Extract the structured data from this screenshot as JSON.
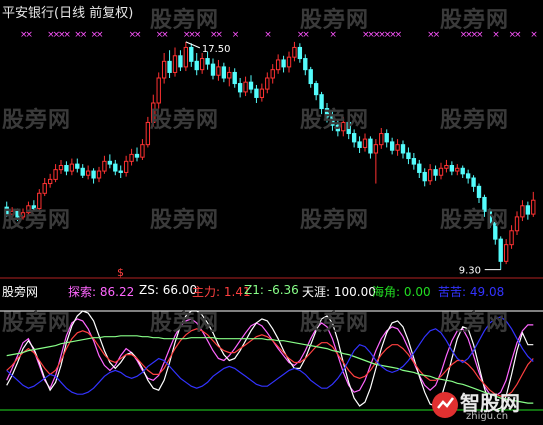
{
  "title": "平安银行(日线 前复权)",
  "watermark": "股旁网",
  "price_high_label": "17.50",
  "price_low_label": "9.30",
  "dollar_marker": "$",
  "indicator_bar": {
    "name": "股旁网",
    "items": [
      {
        "label": "探索:",
        "value": "86.22",
        "color": "#ff66ff"
      },
      {
        "label": "ZS:",
        "value": "66.00",
        "color": "#ffffff"
      },
      {
        "label": "主力:",
        "value": "1.41",
        "color": "#ff4040"
      },
      {
        "label": "Z1:",
        "value": "-6.36",
        "color": "#88ff88"
      },
      {
        "label": "天涯:",
        "value": "100.00",
        "color": "#ffffff"
      },
      {
        "label": "海角:",
        "value": "0.00",
        "color": "#22dd22"
      },
      {
        "label": "苦苦:",
        "value": "49.08",
        "color": "#3333ff"
      }
    ]
  },
  "logo": {
    "main": "智股网",
    "sub": "zhigu.cn"
  },
  "colors": {
    "up": "#ff3232",
    "down": "#54fcfc",
    "marker": "#ff55ff"
  },
  "chart_data": [
    {
      "type": "candlestick",
      "title": "平安银行(日线 前复权)",
      "annotations": [
        {
          "label": "17.50",
          "kind": "high"
        },
        {
          "label": "9.30",
          "kind": "low"
        }
      ],
      "ylim": [
        9.0,
        18.0
      ],
      "candles": [
        [
          11.55,
          11.3,
          11.75,
          11.2
        ],
        [
          11.3,
          11.4,
          11.55,
          11.15
        ],
        [
          11.4,
          11.2,
          11.5,
          11.05
        ],
        [
          11.2,
          11.35,
          11.5,
          11.1
        ],
        [
          11.35,
          11.6,
          11.75,
          11.25
        ],
        [
          11.6,
          11.5,
          11.8,
          11.4
        ],
        [
          11.5,
          12.05,
          12.2,
          11.45
        ],
        [
          12.05,
          12.4,
          12.6,
          11.95
        ],
        [
          12.4,
          12.55,
          12.75,
          12.25
        ],
        [
          12.55,
          12.9,
          13.1,
          12.45
        ],
        [
          12.9,
          13.05,
          13.25,
          12.75
        ],
        [
          13.05,
          12.85,
          13.2,
          12.7
        ],
        [
          12.85,
          13.1,
          13.3,
          12.7
        ],
        [
          13.1,
          12.95,
          13.3,
          12.8
        ],
        [
          12.95,
          12.7,
          13.1,
          12.6
        ],
        [
          12.7,
          12.85,
          13.05,
          12.55
        ],
        [
          12.85,
          12.6,
          12.95,
          12.4
        ],
        [
          12.6,
          12.85,
          13.0,
          12.45
        ],
        [
          12.85,
          13.2,
          13.4,
          12.75
        ],
        [
          13.2,
          13.1,
          13.45,
          12.95
        ],
        [
          13.1,
          12.85,
          13.25,
          12.7
        ],
        [
          12.85,
          12.8,
          13.05,
          12.6
        ],
        [
          12.8,
          13.2,
          13.4,
          12.65
        ],
        [
          13.2,
          13.45,
          13.65,
          13.05
        ],
        [
          13.45,
          13.35,
          13.7,
          13.2
        ],
        [
          13.35,
          13.8,
          14.0,
          13.25
        ],
        [
          13.8,
          14.6,
          14.8,
          13.7
        ],
        [
          14.6,
          15.3,
          15.6,
          14.45
        ],
        [
          15.3,
          16.2,
          16.4,
          15.1
        ],
        [
          16.2,
          16.8,
          17.1,
          16.0
        ],
        [
          16.8,
          16.4,
          17.2,
          16.2
        ],
        [
          16.4,
          17.0,
          17.3,
          16.25
        ],
        [
          17.0,
          16.6,
          17.2,
          16.45
        ],
        [
          16.6,
          17.3,
          17.5,
          16.45
        ],
        [
          17.3,
          16.8,
          17.45,
          16.6
        ],
        [
          16.8,
          16.5,
          17.1,
          16.3
        ],
        [
          16.5,
          16.9,
          17.1,
          16.35
        ],
        [
          16.9,
          16.7,
          17.15,
          16.5
        ],
        [
          16.7,
          16.3,
          16.9,
          16.15
        ],
        [
          16.3,
          16.6,
          16.85,
          16.1
        ],
        [
          16.6,
          16.2,
          16.75,
          16.05
        ],
        [
          16.2,
          16.4,
          16.6,
          15.9
        ],
        [
          16.4,
          16.0,
          16.55,
          15.85
        ],
        [
          16.0,
          15.7,
          16.2,
          15.5
        ],
        [
          15.7,
          16.05,
          16.25,
          15.55
        ],
        [
          16.05,
          15.8,
          16.3,
          15.65
        ],
        [
          15.8,
          15.5,
          15.95,
          15.3
        ],
        [
          15.5,
          15.8,
          16.0,
          15.35
        ],
        [
          15.8,
          16.2,
          16.4,
          15.65
        ],
        [
          16.2,
          16.5,
          16.7,
          16.0
        ],
        [
          16.5,
          16.85,
          17.05,
          16.35
        ],
        [
          16.85,
          16.6,
          17.0,
          16.4
        ],
        [
          16.6,
          16.95,
          17.15,
          16.4
        ],
        [
          16.95,
          17.3,
          17.5,
          16.8
        ],
        [
          17.3,
          16.9,
          17.45,
          16.75
        ],
        [
          16.9,
          16.5,
          17.05,
          16.3
        ],
        [
          16.5,
          16.0,
          16.6,
          15.85
        ],
        [
          16.0,
          15.6,
          16.1,
          15.4
        ],
        [
          15.6,
          15.1,
          15.7,
          14.9
        ],
        [
          15.1,
          14.8,
          15.3,
          14.6
        ],
        [
          14.8,
          14.5,
          15.0,
          14.3
        ],
        [
          14.5,
          14.3,
          14.7,
          14.1
        ],
        [
          14.3,
          14.6,
          14.8,
          14.1
        ],
        [
          14.6,
          14.2,
          14.75,
          14.0
        ],
        [
          14.2,
          13.9,
          14.35,
          13.7
        ],
        [
          13.9,
          13.7,
          14.1,
          13.5
        ],
        [
          13.7,
          14.0,
          14.2,
          13.55
        ],
        [
          14.0,
          13.5,
          14.1,
          13.3
        ],
        [
          13.5,
          13.8,
          14.0,
          12.4
        ],
        [
          13.8,
          14.2,
          14.4,
          13.65
        ],
        [
          14.2,
          13.9,
          14.35,
          13.7
        ],
        [
          13.9,
          13.6,
          14.05,
          13.45
        ],
        [
          13.6,
          13.8,
          14.0,
          13.4
        ],
        [
          13.8,
          13.5,
          13.95,
          13.3
        ],
        [
          13.5,
          13.3,
          13.7,
          13.1
        ],
        [
          13.3,
          13.1,
          13.5,
          12.9
        ],
        [
          13.1,
          12.8,
          13.25,
          12.6
        ],
        [
          12.8,
          12.5,
          12.95,
          12.3
        ],
        [
          12.5,
          12.9,
          13.1,
          12.35
        ],
        [
          12.9,
          12.7,
          13.05,
          12.5
        ],
        [
          12.7,
          12.95,
          13.15,
          12.55
        ],
        [
          12.95,
          13.05,
          13.25,
          12.8
        ],
        [
          13.05,
          12.85,
          13.2,
          12.7
        ],
        [
          12.85,
          12.95,
          13.1,
          12.7
        ],
        [
          12.95,
          12.75,
          13.05,
          12.6
        ],
        [
          12.75,
          12.6,
          12.9,
          12.4
        ],
        [
          12.6,
          12.3,
          12.7,
          12.1
        ],
        [
          12.3,
          11.9,
          12.4,
          11.7
        ],
        [
          11.9,
          11.4,
          12.0,
          11.2
        ],
        [
          11.4,
          11.0,
          11.5,
          10.8
        ],
        [
          11.0,
          10.4,
          11.1,
          10.2
        ],
        [
          10.4,
          9.6,
          10.5,
          9.3
        ],
        [
          9.6,
          10.2,
          10.4,
          9.5
        ],
        [
          10.2,
          10.7,
          10.9,
          10.05
        ],
        [
          10.7,
          11.2,
          11.4,
          10.55
        ],
        [
          11.2,
          11.6,
          11.8,
          11.05
        ],
        [
          11.6,
          11.3,
          11.75,
          11.1
        ],
        [
          11.3,
          11.8,
          12.1,
          11.2
        ]
      ]
    },
    {
      "type": "line",
      "ylim": [
        0,
        100
      ],
      "series": [
        {
          "name": "探索",
          "color": "#ff66ff",
          "values": [
            30,
            42,
            55,
            68,
            72,
            60,
            45,
            30,
            22,
            35,
            55,
            75,
            88,
            92,
            90,
            82,
            70,
            55,
            45,
            40,
            45,
            55,
            62,
            58,
            50,
            40,
            32,
            30,
            35,
            48,
            62,
            75,
            85,
            90,
            92,
            88,
            80,
            70,
            60,
            52,
            50,
            55,
            62,
            70,
            78,
            85,
            88,
            85,
            78,
            70,
            62,
            55,
            48,
            45,
            50,
            60,
            72,
            82,
            88,
            84,
            72,
            55,
            38,
            25,
            18,
            20,
            30,
            45,
            60,
            72,
            80,
            84,
            82,
            74,
            62,
            48,
            35,
            25,
            20,
            25,
            38,
            55,
            70,
            80,
            82,
            72,
            55,
            38,
            24,
            16,
            14,
            18,
            30,
            50,
            68,
            80,
            86,
            86
          ]
        },
        {
          "name": "ZS",
          "color": "#ffffff",
          "values": [
            25,
            35,
            48,
            62,
            70,
            62,
            48,
            32,
            20,
            28,
            45,
            68,
            85,
            95,
            100,
            98,
            90,
            75,
            60,
            48,
            42,
            48,
            56,
            58,
            52,
            42,
            30,
            22,
            20,
            30,
            48,
            68,
            85,
            95,
            100,
            100,
            96,
            88,
            78,
            66,
            56,
            50,
            52,
            60,
            70,
            80,
            88,
            92,
            90,
            82,
            72,
            60,
            50,
            42,
            42,
            52,
            66,
            80,
            92,
            95,
            88,
            70,
            48,
            28,
            12,
            4,
            8,
            22,
            42,
            62,
            78,
            88,
            90,
            84,
            70,
            52,
            34,
            18,
            6,
            4,
            12,
            30,
            52,
            72,
            84,
            82,
            66,
            44,
            22,
            6,
            0,
            2,
            14,
            36,
            60,
            78,
            66,
            66
          ]
        },
        {
          "name": "主力",
          "color": "#ff4040",
          "values": [
            40,
            45,
            52,
            58,
            62,
            58,
            50,
            42,
            36,
            40,
            50,
            62,
            72,
            78,
            80,
            78,
            72,
            64,
            56,
            50,
            48,
            52,
            56,
            56,
            52,
            46,
            40,
            36,
            36,
            42,
            52,
            62,
            70,
            76,
            80,
            82,
            80,
            76,
            70,
            64,
            60,
            58,
            58,
            62,
            66,
            70,
            74,
            76,
            74,
            70,
            64,
            58,
            52,
            48,
            48,
            52,
            58,
            64,
            68,
            68,
            64,
            56,
            48,
            40,
            34,
            32,
            34,
            40,
            48,
            56,
            62,
            66,
            66,
            62,
            56,
            48,
            40,
            34,
            30,
            30,
            34,
            40,
            46,
            50,
            50,
            46,
            40,
            32,
            26,
            20,
            16,
            14,
            14,
            18,
            26,
            36,
            46,
            52
          ]
        },
        {
          "name": "Z1",
          "color": "#88ff88",
          "values": [
            55,
            56,
            57,
            58,
            60,
            61,
            62,
            63,
            64,
            65,
            67,
            68,
            69,
            70,
            71,
            72,
            73,
            73,
            74,
            74,
            74,
            75,
            75,
            75,
            75,
            74,
            74,
            73,
            73,
            72,
            72,
            72,
            72,
            72,
            73,
            73,
            73,
            73,
            73,
            72,
            72,
            72,
            72,
            72,
            72,
            72,
            72,
            72,
            71,
            71,
            70,
            70,
            69,
            68,
            67,
            66,
            65,
            64,
            63,
            62,
            60,
            59,
            57,
            56,
            54,
            52,
            50,
            48,
            46,
            45,
            44,
            43,
            42,
            40,
            39,
            38,
            36,
            35,
            34,
            32,
            31,
            30,
            29,
            27,
            26,
            24,
            22,
            20,
            18,
            16,
            14,
            12,
            11,
            10,
            9,
            8,
            7,
            7
          ]
        },
        {
          "name": "苦苦",
          "color": "#3333ff",
          "values": [
            40,
            35,
            30,
            25,
            22,
            24,
            28,
            32,
            36,
            34,
            28,
            22,
            18,
            16,
            16,
            18,
            22,
            28,
            34,
            38,
            40,
            38,
            34,
            32,
            34,
            38,
            44,
            48,
            52,
            50,
            44,
            38,
            32,
            28,
            24,
            22,
            24,
            28,
            34,
            38,
            42,
            44,
            42,
            38,
            34,
            30,
            26,
            24,
            24,
            28,
            32,
            36,
            40,
            42,
            40,
            36,
            30,
            26,
            22,
            22,
            26,
            32,
            40,
            50,
            60,
            66,
            64,
            58,
            50,
            44,
            40,
            38,
            40,
            44,
            50,
            58,
            66,
            74,
            80,
            82,
            78,
            70,
            60,
            52,
            48,
            52,
            60,
            70,
            80,
            88,
            92,
            94,
            90,
            82,
            72,
            62,
            54,
            49
          ]
        }
      ],
      "hlines": [
        {
          "name": "天涯",
          "value": 100,
          "color": "#ffffff"
        },
        {
          "name": "海角",
          "value": 0,
          "color": "#22dd22"
        }
      ]
    }
  ]
}
